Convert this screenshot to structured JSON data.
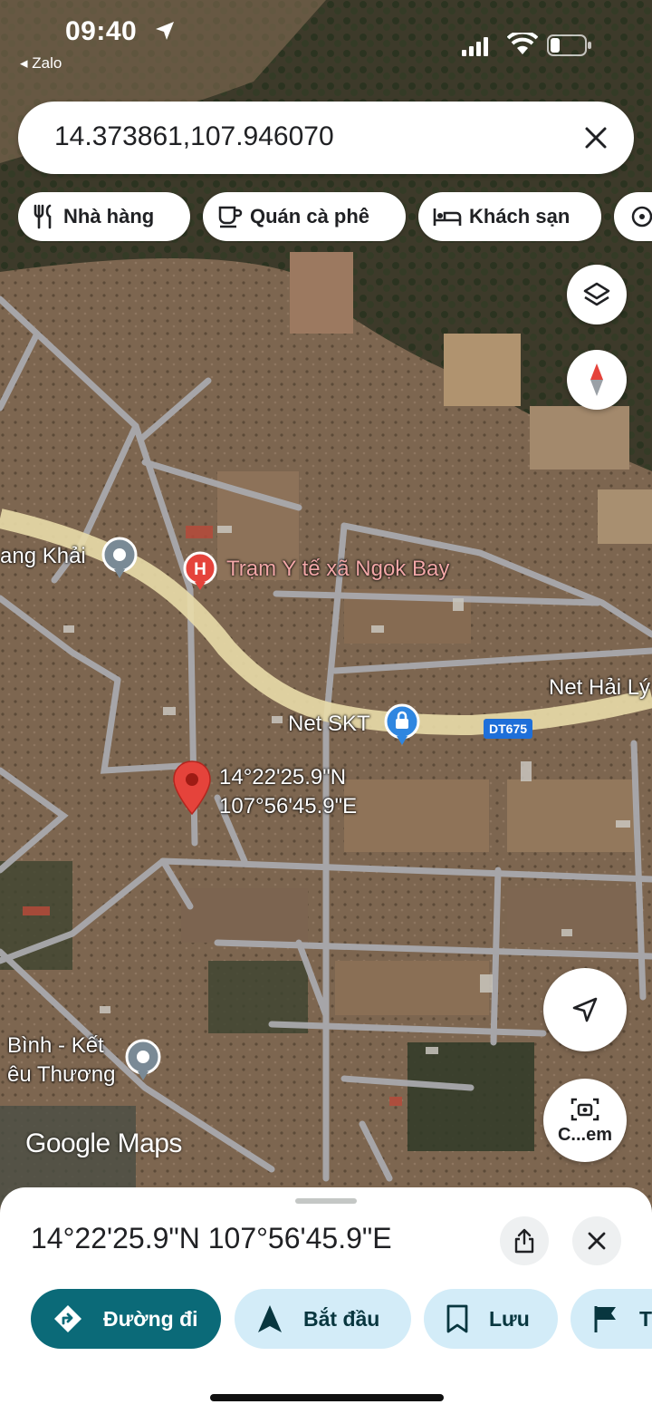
{
  "status_bar": {
    "time": "09:40",
    "back_app": "Zalo"
  },
  "search": {
    "value": "14.373861,107.946070"
  },
  "chips": [
    {
      "label": "Nhà hàng",
      "icon": "restaurant-icon"
    },
    {
      "label": "Quán cà phê",
      "icon": "coffee-icon"
    },
    {
      "label": "Khách sạn",
      "icon": "hotel-icon"
    }
  ],
  "map": {
    "pin_label_lat": "14°22'25.9\"N",
    "pin_label_lng": "107°56'45.9\"E",
    "labels": {
      "poi_1": "ang Khải",
      "poi_hospital": "Trạm Y tế xã Ngọk Bay",
      "poi_net_skt": "Net SKT",
      "poi_net_hai": "Net Hải Lý",
      "poi_bottom_1": "Bình - Kết",
      "poi_bottom_2": "êu Thương",
      "road": "DT675"
    },
    "watermark": "Google Maps",
    "camera_label": "C...em"
  },
  "sheet": {
    "title": "14°22'25.9\"N 107°56'45.9\"E",
    "actions": [
      {
        "label": "Đường đi",
        "icon": "directions-icon"
      },
      {
        "label": "Bắt đầu",
        "icon": "navigation-icon"
      },
      {
        "label": "Lưu",
        "icon": "bookmark-icon"
      },
      {
        "label": "T",
        "icon": "flag-icon"
      }
    ]
  },
  "colors": {
    "primary_action": "#0b6a78",
    "secondary_action": "#d3ecf8",
    "pin": "#e5433b",
    "road_badge": "#1e6fd9"
  }
}
